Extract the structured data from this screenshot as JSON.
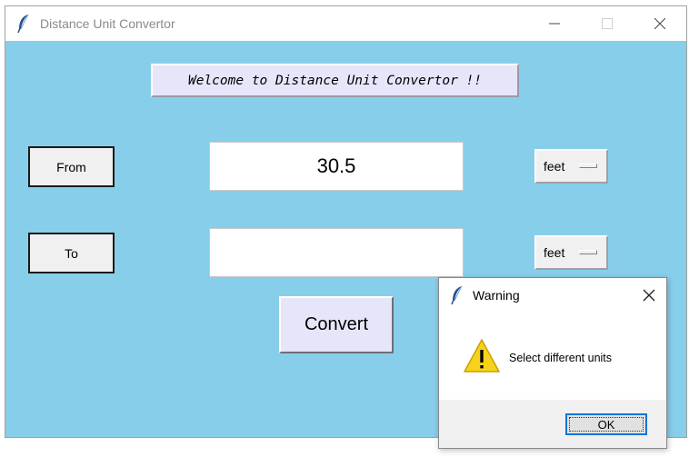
{
  "window": {
    "title": "Distance Unit Convertor",
    "icon": "feather-icon",
    "controls": [
      "minimize-icon",
      "maximize-icon",
      "close-icon"
    ],
    "background": "#87ceeb"
  },
  "banner": {
    "text": "Welcome to Distance Unit Convertor !!"
  },
  "from": {
    "label": "From",
    "value": "30.5",
    "unit": "feet"
  },
  "to": {
    "label": "To",
    "value": "",
    "unit": "feet"
  },
  "convert_button": {
    "label": "Convert"
  },
  "dialog": {
    "title": "Warning",
    "icon": "warning-icon",
    "message": "Select different units",
    "ok_label": "OK",
    "accent": "#0078d7"
  }
}
